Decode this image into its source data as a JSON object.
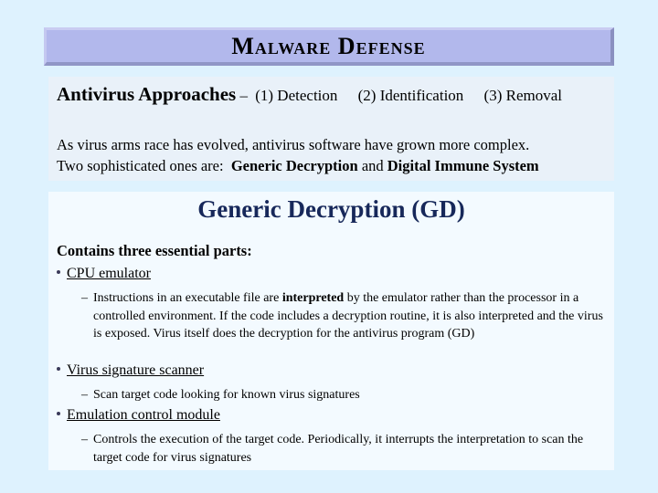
{
  "title": "Malware Defense",
  "intro": {
    "heading": "Antivirus Approaches",
    "separator": "–",
    "approaches": [
      "(1) Detection",
      "(2) Identification",
      "(3) Removal"
    ],
    "line1": "As virus arms race has evolved, antivirus software have grown more complex.",
    "line2_prefix": "Two sophisticated ones are:",
    "line2_bold1": "Generic Decryption",
    "line2_mid": "and",
    "line2_bold2": "Digital Immune System"
  },
  "section": {
    "title": "Generic Decryption (GD)",
    "contains": "Contains three essential parts:",
    "parts": [
      {
        "label": "CPU emulator",
        "desc_pre": "Instructions in an executable file are ",
        "desc_bold": "interpreted",
        "desc_post": " by the emulator rather than the processor in a controlled environment. If the code includes a decryption routine, it is also interpreted and the virus is exposed. Virus itself does the decryption for the antivirus program (GD)"
      },
      {
        "label": "Virus signature scanner",
        "desc": "Scan target code looking for known virus signatures"
      },
      {
        "label": "Emulation control module",
        "desc": "Controls the execution of the target code. Periodically, it interrupts the interpretation to scan the target code for virus signatures"
      }
    ]
  }
}
